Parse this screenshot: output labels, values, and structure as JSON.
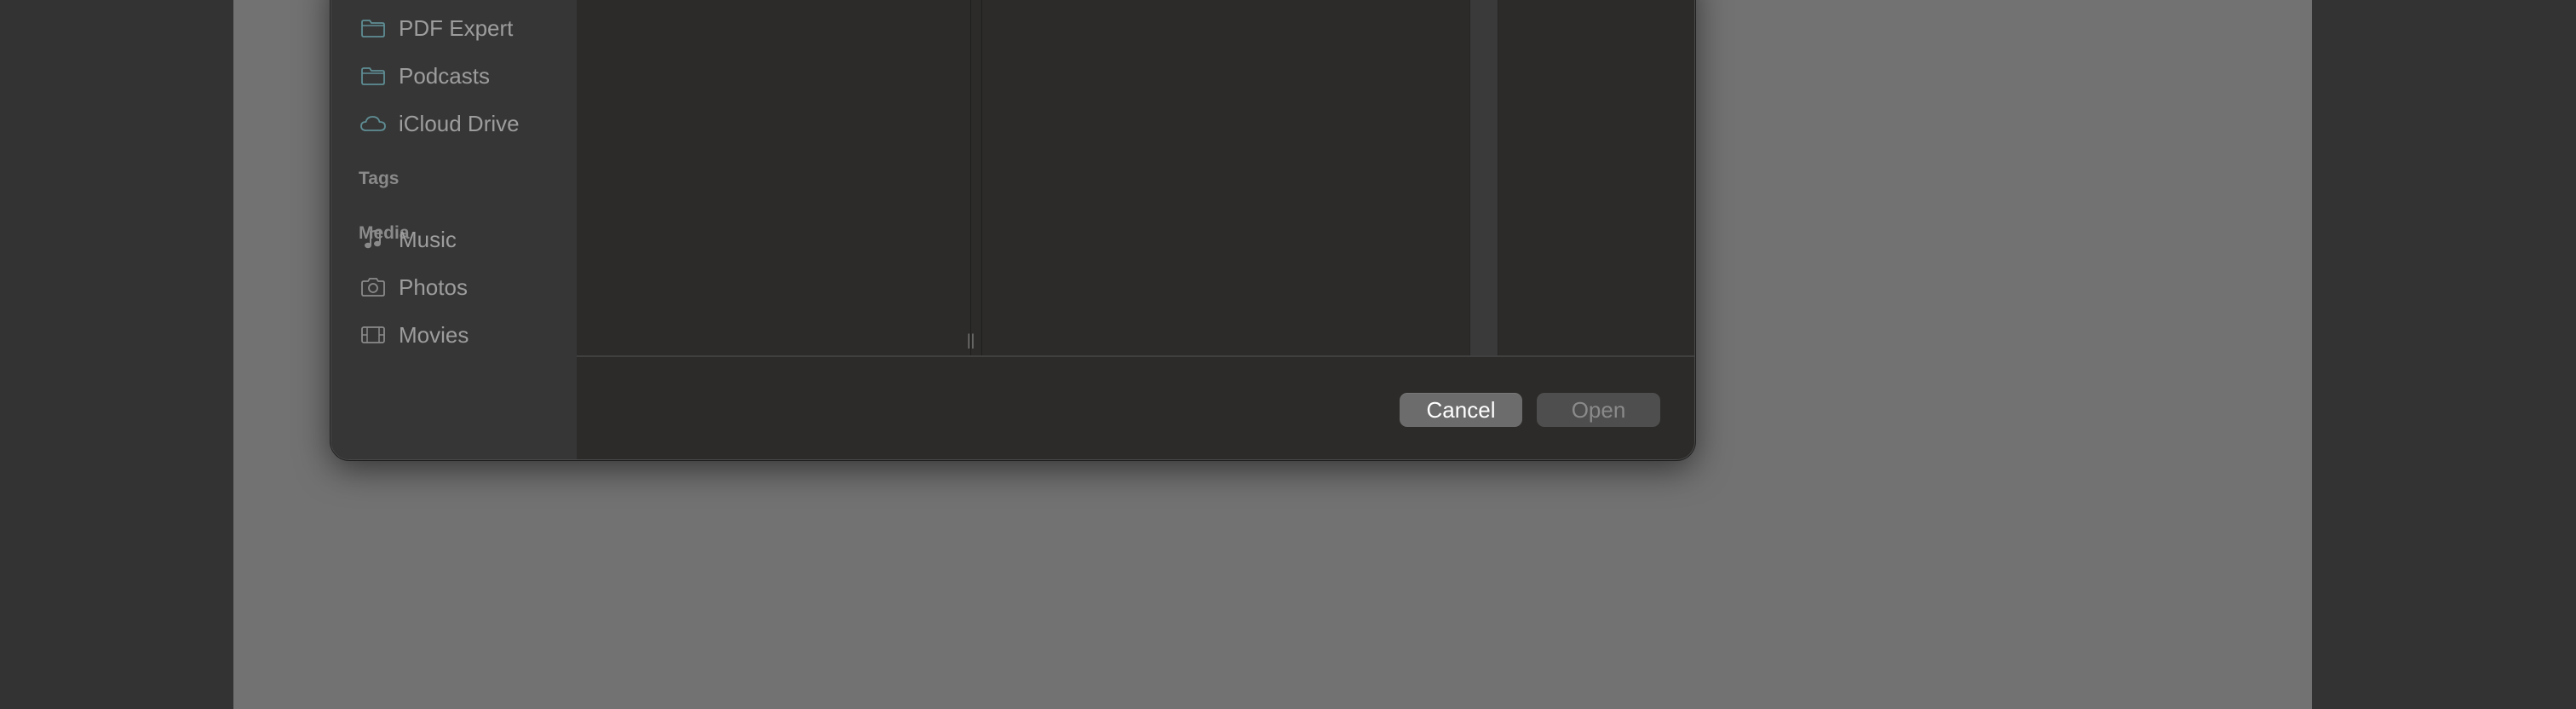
{
  "sidebar": {
    "favorites": [
      {
        "label": "PDF Expert",
        "icon": "folder-icon"
      },
      {
        "label": "Podcasts",
        "icon": "folder-icon"
      },
      {
        "label": "iCloud Drive",
        "icon": "cloud-icon"
      }
    ],
    "tags_heading": "Tags",
    "media_heading": "Media",
    "media": [
      {
        "label": "Music",
        "icon": "music-note-icon"
      },
      {
        "label": "Photos",
        "icon": "camera-icon"
      },
      {
        "label": "Movies",
        "icon": "film-icon"
      }
    ]
  },
  "footer": {
    "cancel_label": "Cancel",
    "open_label": "Open"
  },
  "colors": {
    "icon_teal": "#5f8e95",
    "sidebar_bg": "#363636",
    "dialog_bg": "#2c2b29",
    "document_bg": "#727272"
  }
}
